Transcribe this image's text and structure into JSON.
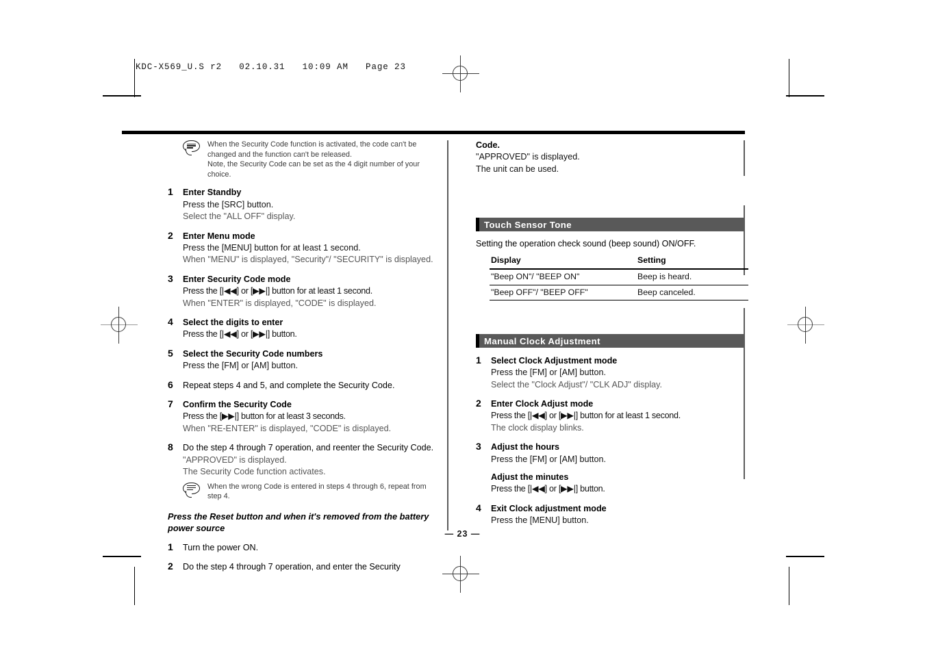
{
  "header": {
    "fileinfo": "KDC-X569_U.S r2   02.10.31   10:09 AM   Page 23"
  },
  "page_number": "— 23 —",
  "left_column": {
    "note_top": [
      "When the Security Code function is activated, the code can't be changed and the function can't be released.",
      "Note, the Security Code can be set as the 4 digit number of your choice."
    ],
    "steps": [
      {
        "num": "1",
        "heading": "Enter Standby",
        "lines": [
          {
            "text": "Press the [SRC] button.",
            "gray": false
          },
          {
            "text": "Select the \"ALL OFF\" display.",
            "gray": true
          }
        ]
      },
      {
        "num": "2",
        "heading": "Enter Menu mode",
        "lines": [
          {
            "text": "Press the [MENU] button for at least 1 second.",
            "gray": false
          },
          {
            "text": "When \"MENU\" is displayed, \"Security\"/ \"SECURITY\" is displayed.",
            "gray": true
          }
        ]
      },
      {
        "num": "3",
        "heading": "Enter Security Code mode",
        "lines": [
          {
            "text": "Press the [|◀◀] or [▶▶|] button for at least 1 second.",
            "gray": false
          },
          {
            "text": "When \"ENTER\" is displayed, \"CODE\" is displayed.",
            "gray": true
          }
        ]
      },
      {
        "num": "4",
        "heading": "Select the digits to enter",
        "lines": [
          {
            "text": "Press the [|◀◀] or [▶▶|] button.",
            "gray": false
          }
        ]
      },
      {
        "num": "5",
        "heading": "Select the Security Code numbers",
        "lines": [
          {
            "text": "Press the [FM] or [AM] button.",
            "gray": false
          }
        ]
      },
      {
        "num": "6",
        "heading": "",
        "plain": "Repeat steps 4 and 5, and complete the Security Code.",
        "lines": []
      },
      {
        "num": "7",
        "heading": "Confirm the Security Code",
        "lines": [
          {
            "text": "Press the [▶▶|] button for at least 3 seconds.",
            "gray": false
          },
          {
            "text": "When \"RE-ENTER\" is displayed, \"CODE\" is displayed.",
            "gray": true
          }
        ]
      },
      {
        "num": "8",
        "heading": "",
        "plain": "Do the step 4 through 7 operation, and reenter the Security Code.",
        "lines": [
          {
            "text": "\"APPROVED\" is displayed.",
            "gray": true
          },
          {
            "text": "The Security Code function activates.",
            "gray": true
          }
        ]
      }
    ],
    "note_bottom": [
      "When the wrong Code is entered in steps 4 through 6, repeat from step 4."
    ],
    "reset_heading": "Press the Reset button and when it's removed from the battery power source",
    "reset_steps": [
      {
        "num": "1",
        "plain": "Turn the power ON."
      },
      {
        "num": "2",
        "plain": "Do the step 4 through 7 operation, and enter the Security"
      }
    ]
  },
  "right_column": {
    "continuation": {
      "bold_line": "Code.",
      "lines": [
        "\"APPROVED\" is displayed.",
        "The unit can be used."
      ]
    },
    "touch_sensor": {
      "title": "Touch Sensor Tone",
      "intro": "Setting the operation check sound (beep sound) ON/OFF.",
      "table": {
        "headers": [
          "Display",
          "Setting"
        ],
        "rows": [
          [
            "\"Beep ON\"/ \"BEEP ON\"",
            "Beep is heard."
          ],
          [
            "\"Beep OFF\"/ \"BEEP OFF\"",
            "Beep canceled."
          ]
        ]
      }
    },
    "manual_clock": {
      "title": "Manual Clock Adjustment",
      "steps": [
        {
          "num": "1",
          "heading": "Select Clock Adjustment mode",
          "lines": [
            {
              "text": "Press the [FM] or [AM] button.",
              "gray": false
            },
            {
              "text": "Select the \"Clock Adjust\"/ \"CLK ADJ\" display.",
              "gray": true
            }
          ]
        },
        {
          "num": "2",
          "heading": "Enter Clock Adjust mode",
          "lines": [
            {
              "text": "Press the [|◀◀] or [▶▶|] button for at least 1 second.",
              "gray": false
            },
            {
              "text": "The clock display blinks.",
              "gray": true
            }
          ]
        },
        {
          "num": "3",
          "heading": "Adjust the hours",
          "lines": [
            {
              "text": "Press the [FM] or [AM] button.",
              "gray": false
            }
          ],
          "sub_heading": "Adjust the minutes",
          "sub_lines": [
            {
              "text": "Press the [|◀◀] or [▶▶|] button.",
              "gray": false
            }
          ]
        },
        {
          "num": "4",
          "heading": "Exit Clock adjustment mode",
          "lines": [
            {
              "text": "Press the [MENU] button.",
              "gray": false
            }
          ]
        }
      ]
    }
  }
}
